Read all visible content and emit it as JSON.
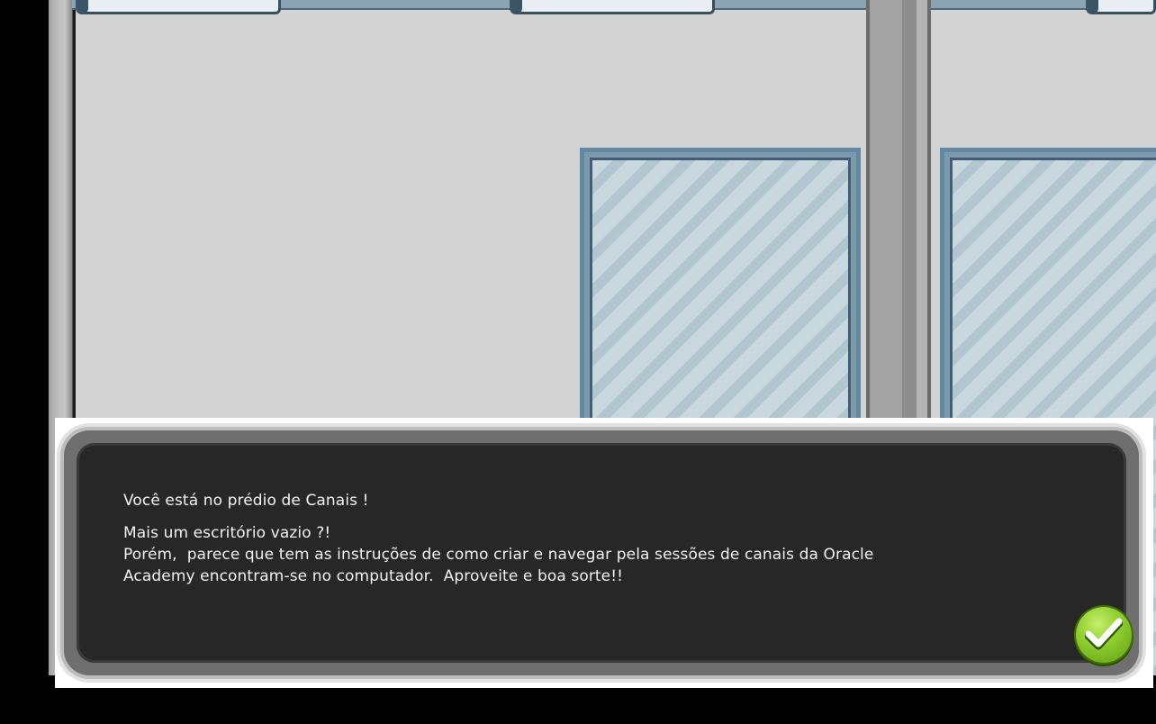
{
  "dialog": {
    "line_1": "Você está no prédio de Canais !",
    "line_2": "Mais um escritório vazio ?!",
    "line_3": "Porém,  parece que tem as instruções de como criar e navegar pela sessões de canais da Oracle",
    "line_4": "Academy encontram-se no computador.  Aproveite e boa sorte!!",
    "confirm_icon": "checkmark-icon"
  },
  "colors": {
    "background": "#000000",
    "wall": "#d3d3d3",
    "window_frame": "#5f8aa1",
    "window_glass": "#c9d8df",
    "dialog_box": "#272727",
    "dialog_text": "#f2f2f2",
    "confirm_button": "#8ccc2c"
  }
}
